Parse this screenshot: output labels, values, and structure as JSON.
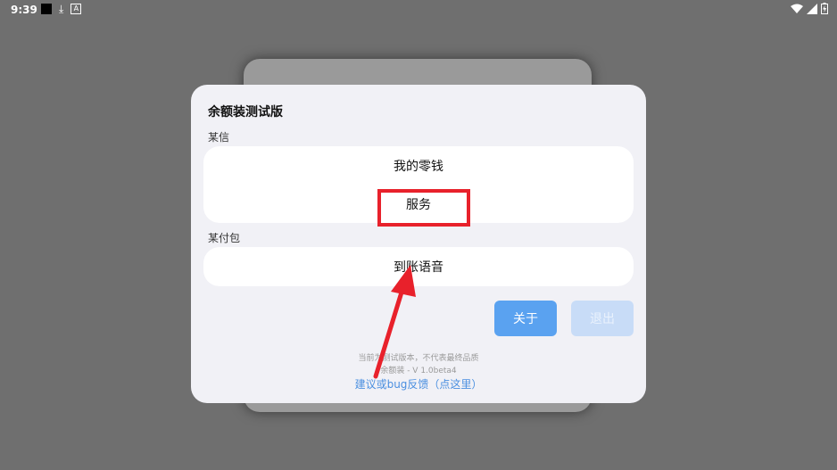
{
  "status_bar": {
    "time": "9:39",
    "left_icons": [
      "black-square-icon",
      "download-icon",
      "a-badge-icon"
    ],
    "right_icons": [
      "wifi-icon",
      "signal-icon",
      "battery-icon"
    ]
  },
  "dialog": {
    "title": "余额装测试版",
    "sections": [
      {
        "label": "某信",
        "items": [
          "我的零钱",
          "服务"
        ]
      },
      {
        "label": "某付包",
        "items": [
          "到账语音"
        ]
      }
    ],
    "buttons": {
      "about": "关于",
      "exit": "退出"
    },
    "footer_line1": "当前为测试版本，不代表最终品质",
    "footer_line2": "余额装 - V 1.0beta4",
    "feedback_link": "建议或bug反馈（点这里）"
  },
  "colors": {
    "accent": "#5aa2f0",
    "exit_button": "#c8dcf7",
    "link": "#4a8fe0",
    "annotation": "#e8212b"
  }
}
